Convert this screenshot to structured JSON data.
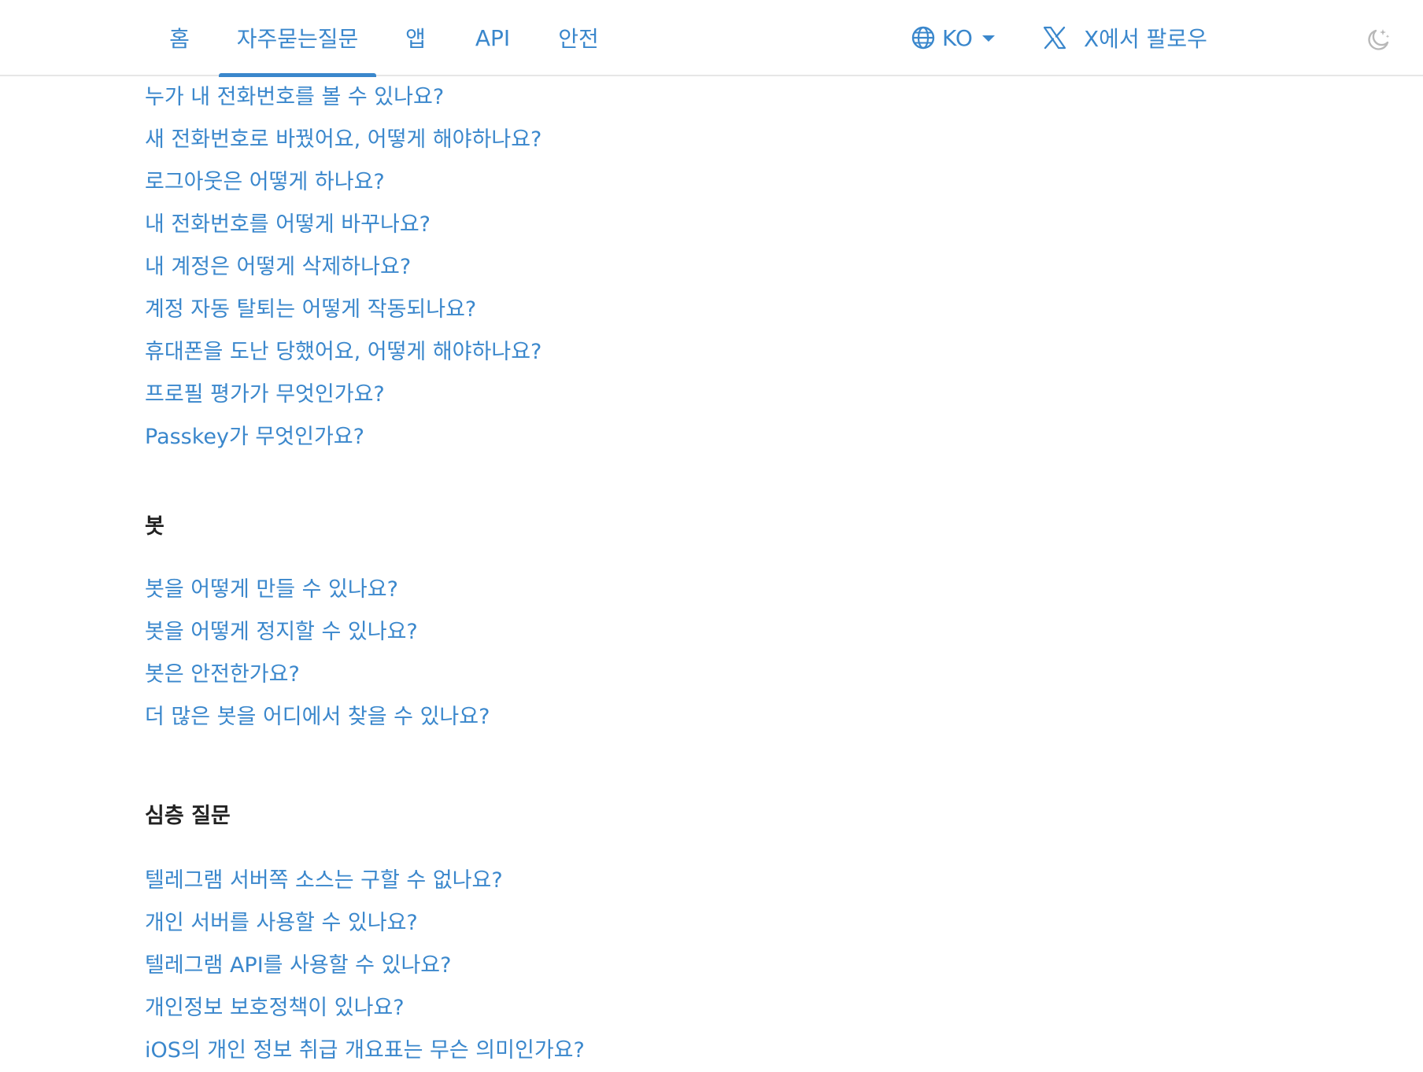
{
  "nav": {
    "items": [
      {
        "label": "홈"
      },
      {
        "label": "자주묻는질문",
        "active": true
      },
      {
        "label": "앱"
      },
      {
        "label": "API"
      },
      {
        "label": "안전"
      }
    ],
    "language": "KO",
    "follow_label": "X에서 팔로우"
  },
  "colors": {
    "link": "#3a87cc",
    "heading": "#222222",
    "divider": "#e6e6e6"
  },
  "icons": {
    "language": "globe-icon",
    "dropdown": "caret-down-icon",
    "follow": "x-logo-icon",
    "theme": "moon-stars-icon"
  },
  "sections": {
    "account_links": [
      "누가 내 전화번호를 볼 수 있나요?",
      "새 전화번호로 바꿨어요, 어떻게 해야하나요?",
      "로그아웃은 어떻게 하나요?",
      "내 전화번호를 어떻게 바꾸나요?",
      "내 계정은 어떻게 삭제하나요?",
      "계정 자동 탈퇴는 어떻게 작동되나요?",
      "휴대폰을 도난 당했어요, 어떻게 해야하나요?",
      "프로필 평가가 무엇인가요?",
      "Passkey가 무엇인가요?"
    ],
    "bots": {
      "title": "봇",
      "links": [
        "봇을 어떻게 만들 수 있나요?",
        "봇을 어떻게 정지할 수 있나요?",
        "봇은 안전한가요?",
        "더 많은 봇을 어디에서 찾을 수 있나요?"
      ]
    },
    "deep": {
      "title": "심층 질문",
      "links": [
        "텔레그램 서버쪽 소스는 구할 수 없나요?",
        "개인 서버를 사용할 수 있나요?",
        "텔레그램 API를 사용할 수 있나요?",
        "개인정보 보호정책이 있나요?",
        "iOS의 개인 정보 취급 개요표는 무슨 의미인가요?"
      ]
    }
  }
}
